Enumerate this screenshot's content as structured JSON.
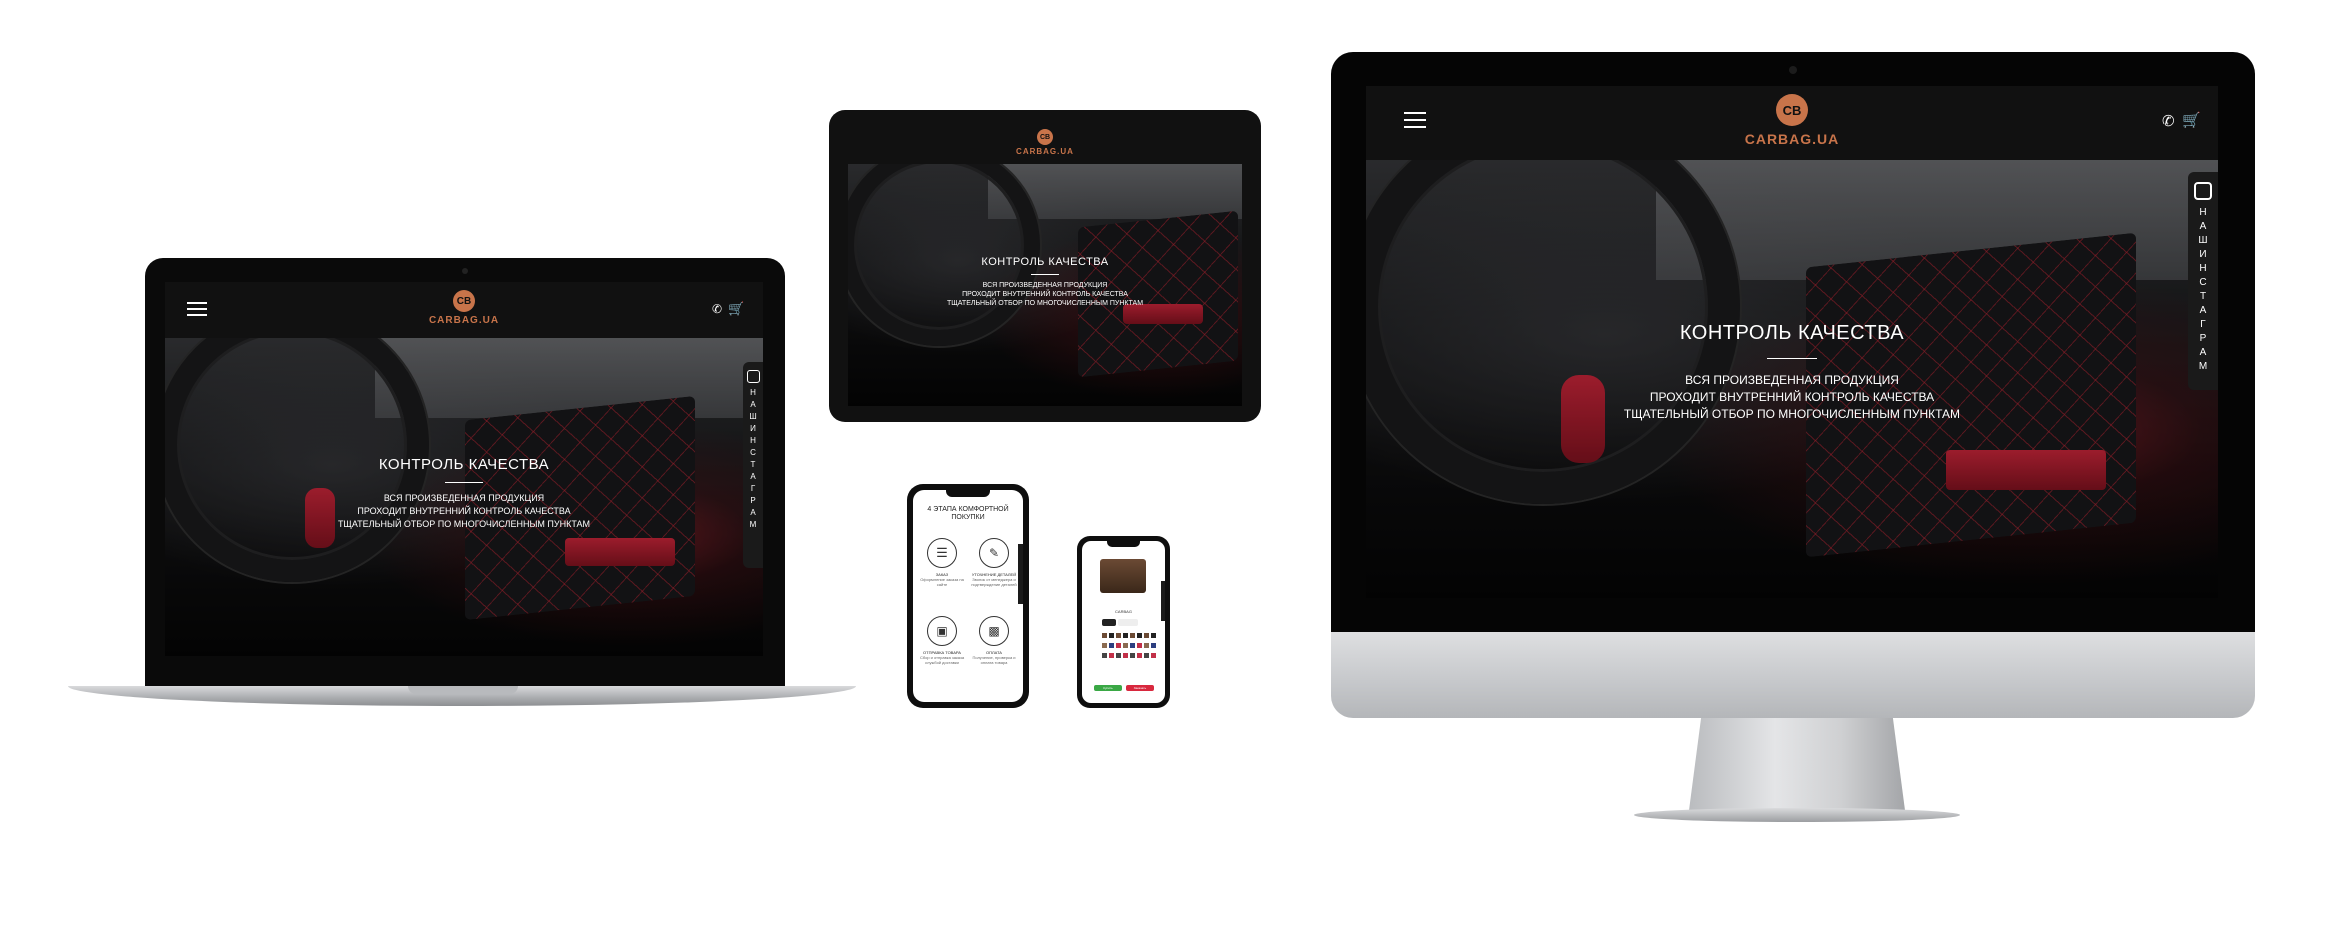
{
  "site": {
    "logo_mark": "CB",
    "logo_text": "CARBAG.UA",
    "hero_title": "КОНТРОЛЬ КАЧЕСТВА",
    "hero_line1": "ВСЯ ПРОИЗВЕДЕННАЯ ПРОДУКЦИЯ",
    "hero_line2": "ПРОХОДИТ ВНУТРЕННИЙ КОНТРОЛЬ КАЧЕСТВА",
    "hero_line3": "ТЩАТЕЛЬНЫЙ ОТБОР ПО МНОГОЧИСЛЕННЫМ ПУНКТАМ",
    "insta_label": "НАШ ИНСТАГРАМ",
    "phone_icon": "phone-icon",
    "cart_icon": "cart-icon",
    "menu_icon": "hamburger-menu-icon",
    "instagram_icon": "instagram-icon"
  },
  "phone_a": {
    "title": "4 ЭТАПА КОМФОРТНОЙ ПОКУПКИ",
    "steps": [
      {
        "label": "ЗАКАЗ",
        "desc": "Оформление заказа на сайте"
      },
      {
        "label": "УТОЧНЕНИЕ ДЕТАЛЕЙ",
        "desc": "Звонок от менеджера и подтверждение деталей"
      },
      {
        "label": "ОТПРАВКА ТОВАРА",
        "desc": "Сбор и отправка заказа службой доставки"
      },
      {
        "label": "ОПЛАТА",
        "desc": "Получение, проверка и оплата товара"
      }
    ]
  },
  "phone_b": {
    "product_label": "CARBAG",
    "buy_label": "Купить",
    "cancel_label": "Заказать"
  },
  "colors": {
    "accent": "#c8744a",
    "red": "#d8283e",
    "dark": "#0b0b0b"
  }
}
